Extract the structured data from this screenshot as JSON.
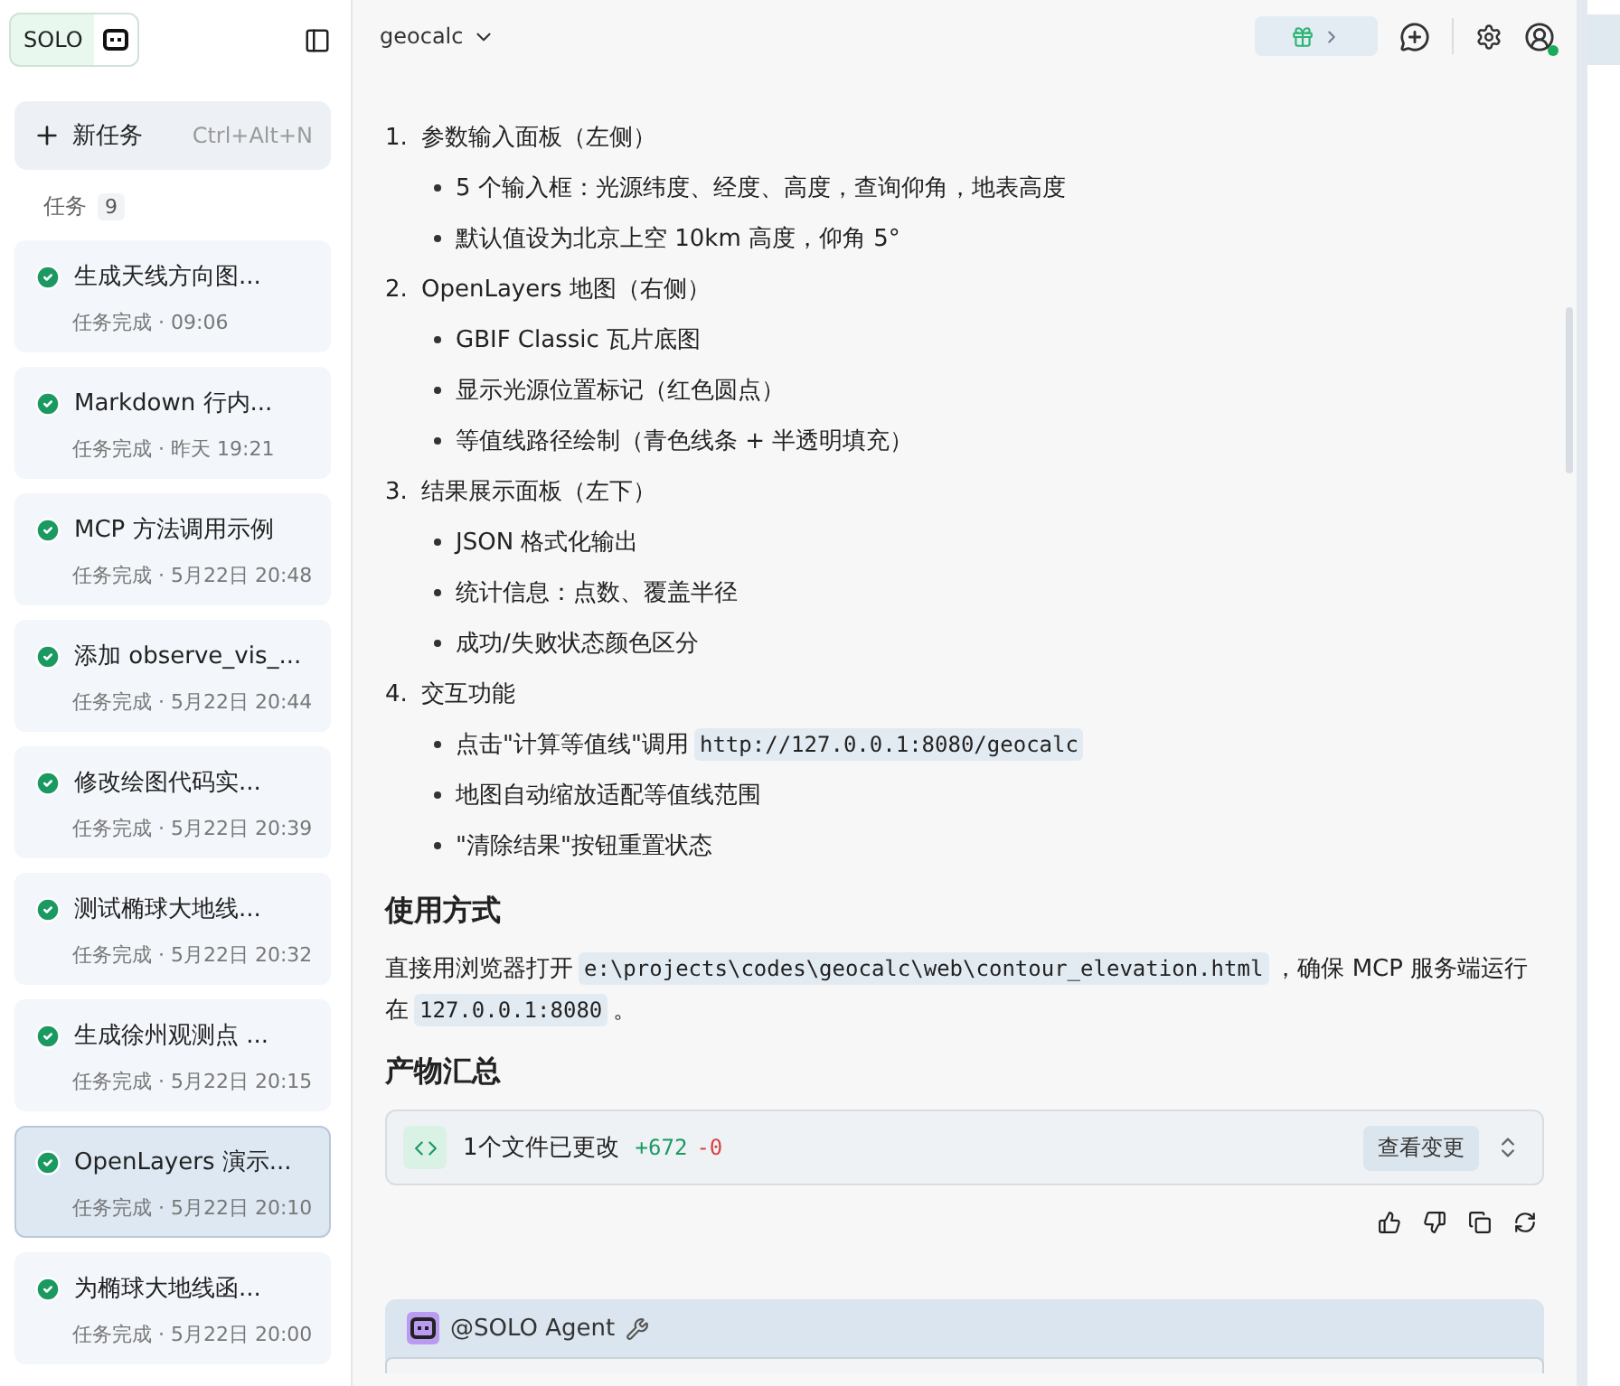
{
  "sidebar": {
    "brand": "SOLO",
    "new_task": {
      "label": "新任务",
      "shortcut": "Ctrl+Alt+N"
    },
    "section": {
      "label": "任务",
      "count": "9"
    },
    "tasks": [
      {
        "title": "生成天线方向图...",
        "status": "任务完成 · 09:06",
        "selected": false
      },
      {
        "title": "Markdown 行内...",
        "status": "任务完成 · 昨天 19:21",
        "selected": false
      },
      {
        "title": "MCP 方法调用示例",
        "status": "任务完成 · 5月22日 20:48",
        "selected": false
      },
      {
        "title": "添加 observe_vis_...",
        "status": "任务完成 · 5月22日 20:44",
        "selected": false
      },
      {
        "title": "修改绘图代码实...",
        "status": "任务完成 · 5月22日 20:39",
        "selected": false
      },
      {
        "title": "测试椭球大地线...",
        "status": "任务完成 · 5月22日 20:32",
        "selected": false
      },
      {
        "title": "生成徐州观测点 ...",
        "status": "任务完成 · 5月22日 20:15",
        "selected": false
      },
      {
        "title": "OpenLayers 演示...",
        "status": "任务完成 · 5月22日 20:10",
        "selected": true
      },
      {
        "title": "为椭球大地线函...",
        "status": "任务完成 · 5月22日 20:00",
        "selected": false
      }
    ]
  },
  "toolbar": {
    "project": "geocalc"
  },
  "content": {
    "list": [
      {
        "number": "1.",
        "text": "参数输入面板（左侧）",
        "bullets": [
          [
            {
              "t": "5 个输入框：光源纬度、经度、高度，查询仰角，地表高度"
            }
          ],
          [
            {
              "t": "默认值设为北京上空 10km 高度，仰角 5°"
            }
          ]
        ]
      },
      {
        "number": "2.",
        "text": "OpenLayers 地图（右侧）",
        "bullets": [
          [
            {
              "t": "GBIF Classic 瓦片底图"
            }
          ],
          [
            {
              "t": "显示光源位置标记（红色圆点）"
            }
          ],
          [
            {
              "t": "等值线路径绘制（青色线条 + 半透明填充）"
            }
          ]
        ]
      },
      {
        "number": "3.",
        "text": "结果展示面板（左下）",
        "bullets": [
          [
            {
              "t": "JSON 格式化输出"
            }
          ],
          [
            {
              "t": "统计信息：点数、覆盖半径"
            }
          ],
          [
            {
              "t": "成功/失败状态颜色区分"
            }
          ]
        ]
      },
      {
        "number": "4.",
        "text": "交互功能",
        "bullets": [
          [
            {
              "t": "点击\"计算等值线\"调用"
            },
            {
              "code": "http://127.0.0.1:8080/geocalc"
            }
          ],
          [
            {
              "t": "地图自动缩放适配等值线范围"
            }
          ],
          [
            {
              "t": "\"清除结果\"按钮重置状态"
            }
          ]
        ]
      }
    ],
    "usage_heading": "使用方式",
    "usage": [
      {
        "t": "直接用浏览器打开"
      },
      {
        "code": "e:\\projects\\codes\\geocalc\\web\\contour_elevation.html"
      },
      {
        "t": "，确保 MCP 服务端运行在"
      },
      {
        "code": "127.0.0.1:8080"
      },
      {
        "t": "。"
      }
    ],
    "artifacts_heading": "产物汇总",
    "files": {
      "summary": "1个文件已更改",
      "added": "+672",
      "removed": "-0",
      "button": "查看变更"
    },
    "agent": {
      "label": "@SOLO Agent"
    }
  }
}
